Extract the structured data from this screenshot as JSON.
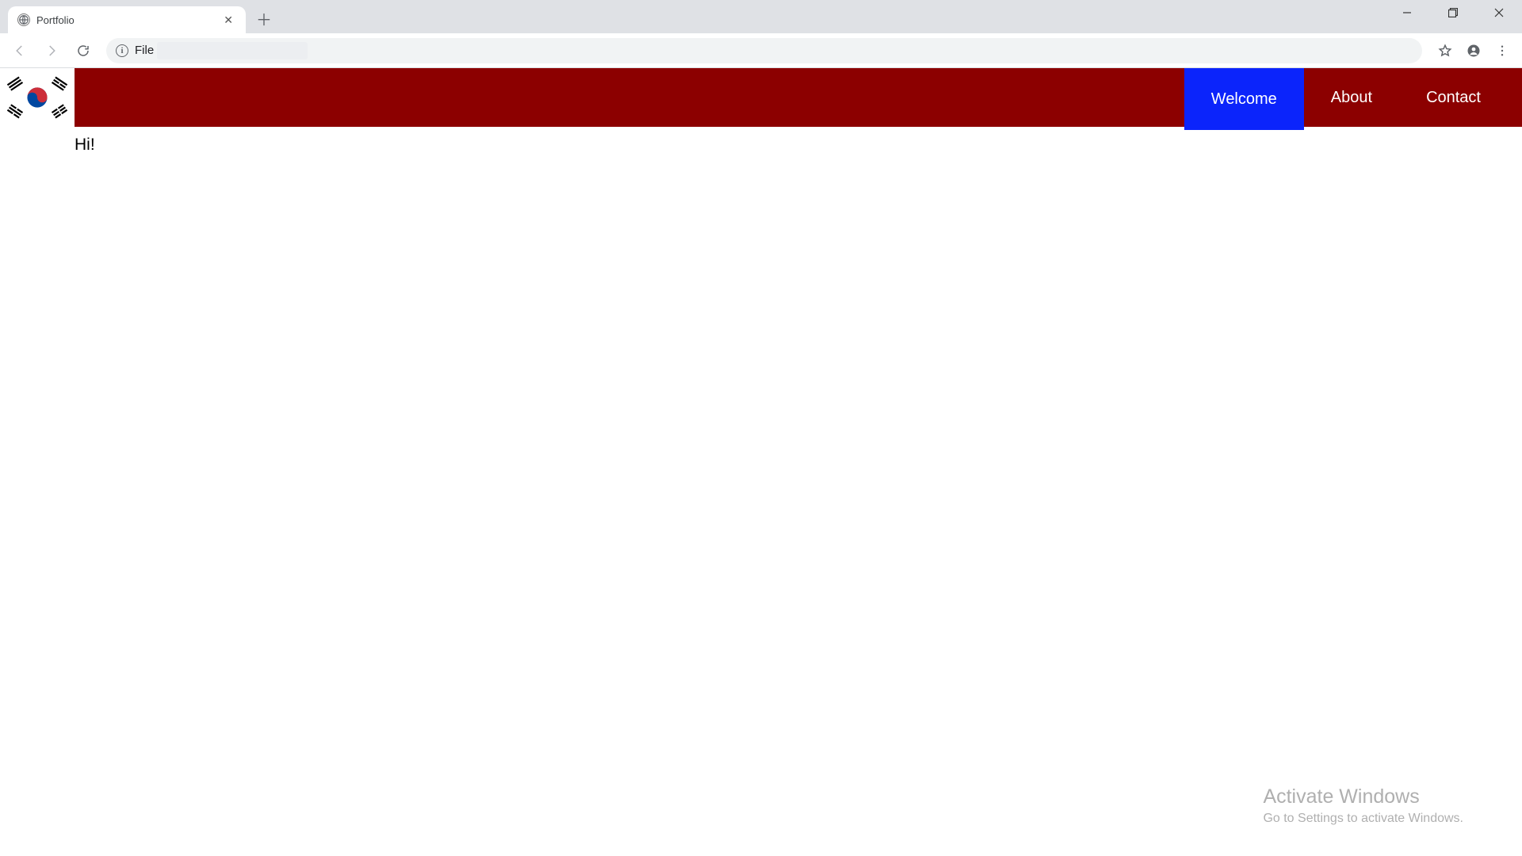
{
  "browser": {
    "tab_title": "Portfolio",
    "address_label": "File"
  },
  "site": {
    "nav": [
      {
        "label": "Welcome",
        "active": true
      },
      {
        "label": "About",
        "active": false
      },
      {
        "label": "Contact",
        "active": false
      }
    ],
    "greeting": "Hi!",
    "logo_alt": "korea-flag"
  },
  "watermark": {
    "line1": "Activate Windows",
    "line2": "Go to Settings to activate Windows."
  },
  "colors": {
    "header_bg": "#8c0000",
    "active_tab_bg": "#0b24fb",
    "nav_text": "#ffffff"
  }
}
